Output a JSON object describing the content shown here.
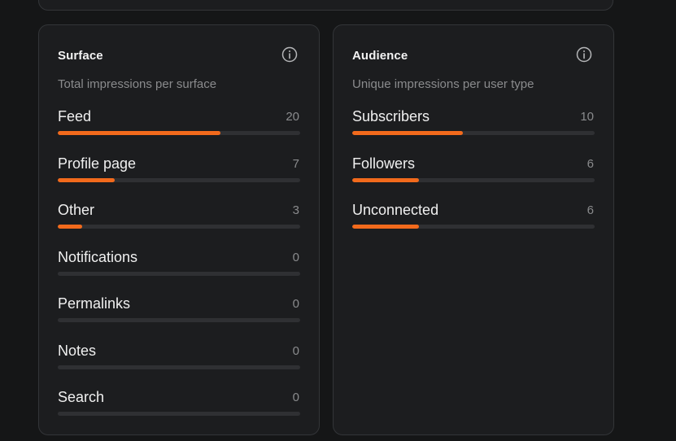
{
  "colors": {
    "accent": "#f26a1c",
    "track": "#2f3033",
    "card_bg": "#1c1d1f",
    "page_bg": "#151617"
  },
  "surface": {
    "title": "Surface",
    "subtitle": "Total impressions per surface",
    "info_icon": "info-circle-icon",
    "max": 30,
    "rows": [
      {
        "label": "Feed",
        "value": 20,
        "fraction": 0.67
      },
      {
        "label": "Profile page",
        "value": 7,
        "fraction": 0.235
      },
      {
        "label": "Other",
        "value": 3,
        "fraction": 0.1
      },
      {
        "label": "Notifications",
        "value": 0,
        "fraction": 0
      },
      {
        "label": "Permalinks",
        "value": 0,
        "fraction": 0
      },
      {
        "label": "Notes",
        "value": 0,
        "fraction": 0
      },
      {
        "label": "Search",
        "value": 0,
        "fraction": 0
      }
    ]
  },
  "audience": {
    "title": "Audience",
    "subtitle": "Unique impressions per user type",
    "info_icon": "info-circle-icon",
    "rows": [
      {
        "label": "Subscribers",
        "value": 10,
        "fraction": 0.457
      },
      {
        "label": "Followers",
        "value": 6,
        "fraction": 0.275
      },
      {
        "label": "Unconnected",
        "value": 6,
        "fraction": 0.275
      }
    ]
  }
}
